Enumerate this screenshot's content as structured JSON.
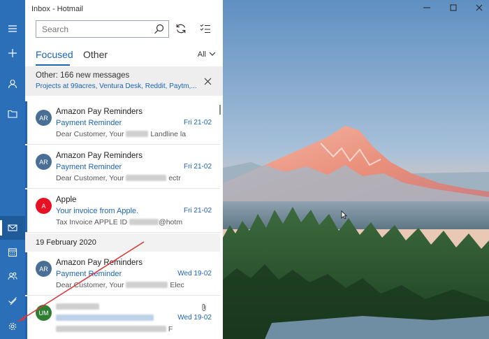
{
  "window": {
    "title": "Inbox - Hotmail"
  },
  "search": {
    "placeholder": "Search"
  },
  "tabs": {
    "focused_label": "Focused",
    "other_label": "Other",
    "filter_label": "All"
  },
  "banner": {
    "title": "Other: 166 new messages",
    "senders": "Projects at 99acres, Ventura Desk, Reddit, Paytm,..."
  },
  "messages": [
    {
      "initials": "AR",
      "avatar_color": "#4a6f96",
      "sender": "Amazon Pay Reminders",
      "subject": "Payment Reminder",
      "preview_start": "Dear Customer, Your",
      "preview_end": "Landline la",
      "date": "Fri 21-02"
    },
    {
      "initials": "AR",
      "avatar_color": "#4a6f96",
      "sender": "Amazon Pay Reminders",
      "subject": "Payment Reminder",
      "preview_start": "Dear Customer, Your",
      "preview_end": "ectr",
      "date": "Fri 21-02"
    },
    {
      "initials": "A",
      "avatar_color": "#e81123",
      "sender": "Apple",
      "subject": "Your invoice from Apple.",
      "preview_start": "Tax Invoice APPLE ID",
      "preview_end": "@hotm",
      "date": "Fri 21-02"
    }
  ],
  "date_group": "19 February 2020",
  "messages_2": [
    {
      "initials": "AR",
      "avatar_color": "#4a6f96",
      "sender": "Amazon Pay Reminders",
      "subject": "Payment Reminder",
      "preview_start": "Dear Customer, Your",
      "preview_end": "Elec",
      "date": "Wed 19-02"
    },
    {
      "initials": "UM",
      "avatar_color": "#2e7d32",
      "sender": "",
      "subject": "",
      "preview_start": "",
      "preview_end": "F",
      "date": "Wed 19-02"
    }
  ],
  "colors": {
    "accent": "#1d63b6",
    "rail": "#2b6fb8"
  }
}
